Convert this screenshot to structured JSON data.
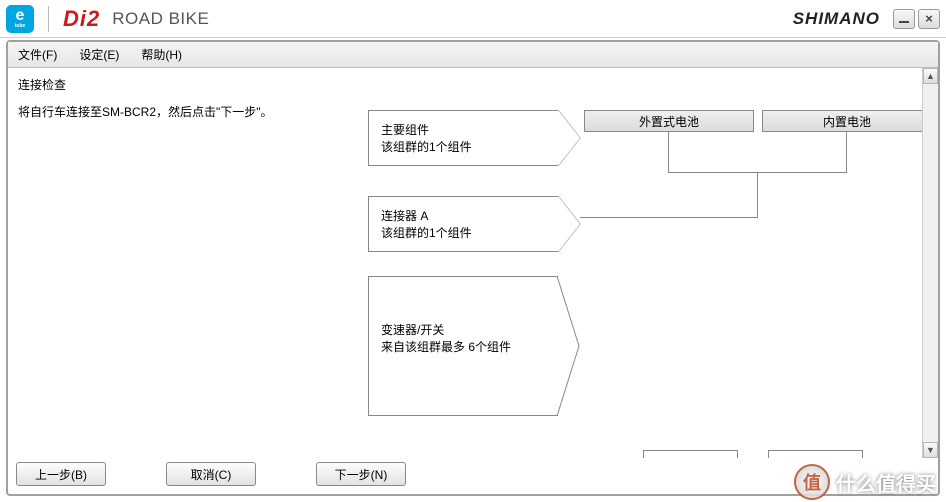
{
  "header": {
    "etube_top": "e",
    "etube_bottom": "tube",
    "brand": "Di2",
    "subtitle": "ROAD BIKE",
    "maker": "SHIMANO"
  },
  "menu": {
    "file": "文件(F)",
    "settings": "设定(E)",
    "help": "帮助(H)"
  },
  "left": {
    "title": "连接检查",
    "instruction": "将自行车连接至SM-BCR2，然后点击\"下一步\"。"
  },
  "buttons": {
    "prev": "上一步(B)",
    "cancel": "取消(C)",
    "next": "下一步(N)"
  },
  "diagram": {
    "group1_title": "主要组件",
    "group1_sub": "该组群的1个组件",
    "group2_title": "连接器 A",
    "group2_sub": "该组群的1个组件",
    "group3_title": "变速器/开关",
    "group3_sub": "来自该组群最多 6个组件",
    "battery_ext": "外置式电池",
    "battery_int": "内置电池"
  },
  "watermark": {
    "badge": "值",
    "text": "什么值得买"
  }
}
